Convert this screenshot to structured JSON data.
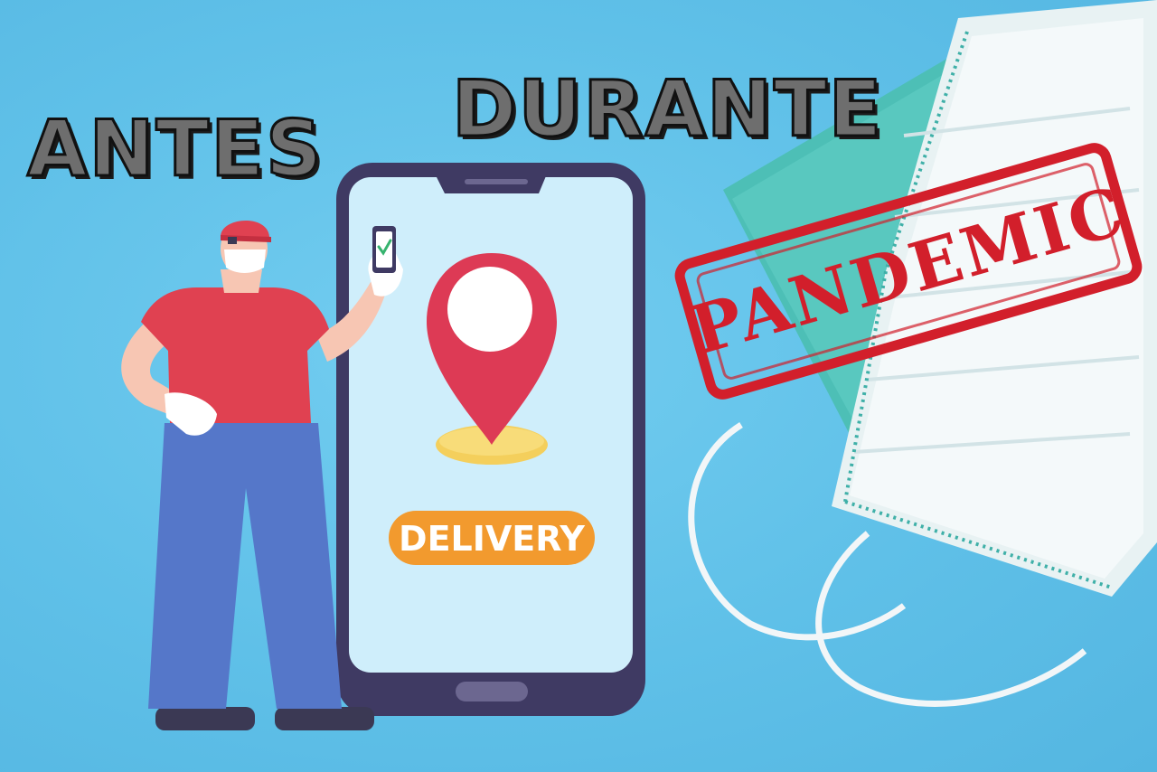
{
  "headline": {
    "before": "ANTES",
    "during": "DURANTE"
  },
  "phone": {
    "button_label": "DELIVERY",
    "pin_icon": "location-pin-icon",
    "check_icon": "checkmark-icon"
  },
  "stamp": {
    "text": "PANDEMIC"
  },
  "colors": {
    "background": "#62c2e6",
    "headline_fill": "#6e6e6e",
    "stamp_red": "#d21f2b",
    "delivery_orange": "#f29a2e",
    "pin_red": "#dd3a55",
    "phone_frame": "#3f3a63",
    "shirt_red": "#e04151",
    "pants_blue": "#5577c9"
  }
}
